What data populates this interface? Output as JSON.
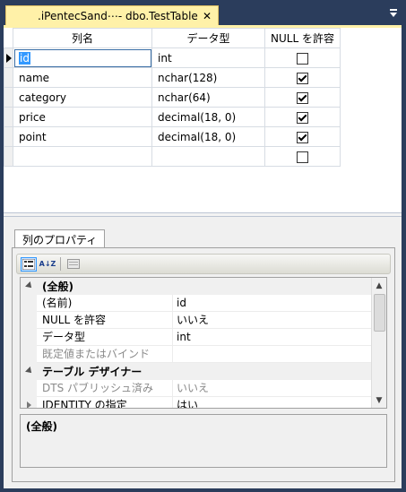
{
  "tab": {
    "title": ".iPentecSand⋯- dbo.TestTable",
    "close_glyph": "✕"
  },
  "columns_header": {
    "name": "列名",
    "type": "データ型",
    "null": "NULL を許容"
  },
  "rows": [
    {
      "name": "id",
      "type": "int",
      "allow_null": false
    },
    {
      "name": "name",
      "type": "nchar(128)",
      "allow_null": true
    },
    {
      "name": "category",
      "type": "nchar(64)",
      "allow_null": true
    },
    {
      "name": "price",
      "type": "decimal(18, 0)",
      "allow_null": true
    },
    {
      "name": "point",
      "type": "decimal(18, 0)",
      "allow_null": true
    },
    {
      "name": "",
      "type": "",
      "allow_null": false
    }
  ],
  "properties_tab": {
    "label": "列のプロパティ"
  },
  "toolbar": {
    "sort_alpha_label": "A↓Z"
  },
  "properties": {
    "cat_general": "(全般)",
    "items_general": [
      {
        "name": "(名前)",
        "value": "id"
      },
      {
        "name": "NULL を許容",
        "value": "いいえ"
      },
      {
        "name": "データ型",
        "value": "int"
      },
      {
        "name": "既定値またはバインド",
        "value": ""
      }
    ],
    "cat_designer": "テーブル デザイナー",
    "items_designer": [
      {
        "name": "DTS パブリッシュ済み",
        "value": "いいえ"
      },
      {
        "name": "IDENTITY の指定",
        "value": "はい"
      }
    ]
  },
  "description": {
    "title": "(全般)",
    "text": ""
  },
  "colors": {
    "frame": "#2b3d5c",
    "tab_active": "#fff1a8",
    "selection": "#3399ff"
  }
}
